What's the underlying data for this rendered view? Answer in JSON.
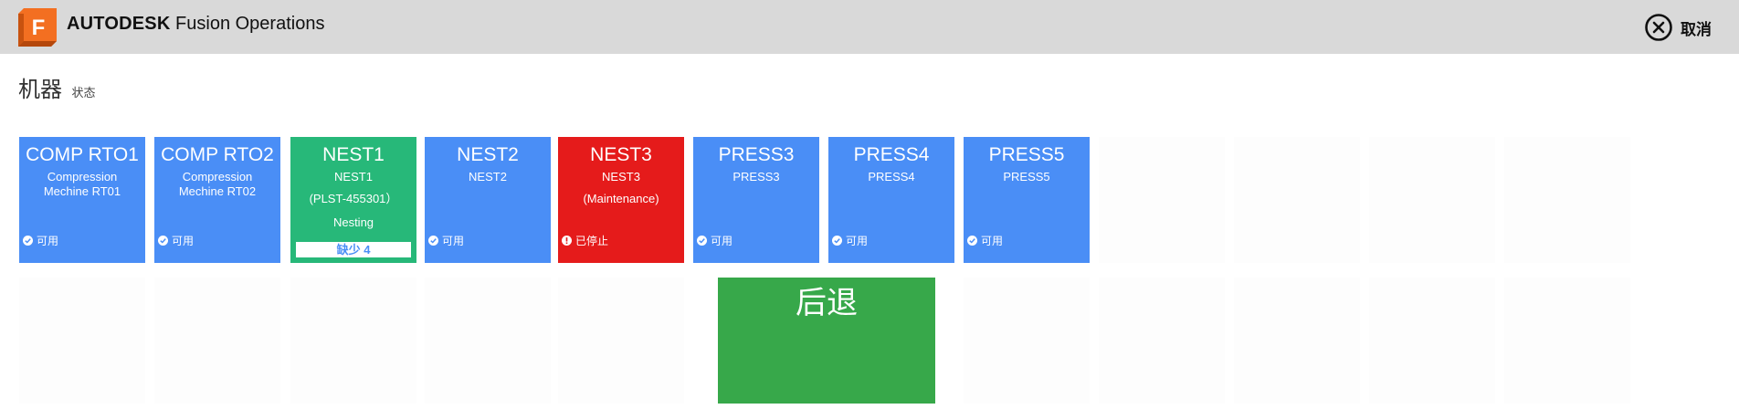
{
  "header": {
    "brand_bold": "AUTODESK",
    "brand_product": "Fusion Operations",
    "logo_letter": "F",
    "cancel_label": "取消"
  },
  "heading": {
    "title": "机器",
    "subtitle": "状态"
  },
  "machines": [
    {
      "name": "COMP RTO1",
      "line1": "Compression",
      "line2": "Mechine RT01",
      "status": "可用",
      "color": "#4a8ef6"
    },
    {
      "name": "COMP RTO2",
      "line1": "Compression",
      "line2": "Mechine RT02",
      "status": "可用",
      "color": "#4a8ef6"
    },
    {
      "name": "NEST1",
      "line1": "NEST1",
      "line2": "(PLST-455301）",
      "line3": "Nesting",
      "missing": "缺少 4",
      "color": "#27b879"
    },
    {
      "name": "NEST2",
      "line1": "NEST2",
      "status": "可用",
      "color": "#4a8ef6"
    },
    {
      "name": "NEST3",
      "line1": "NEST3",
      "line2": "(Maintenance)",
      "status": "已停止",
      "color": "#e51b1b"
    },
    {
      "name": "PRESS3",
      "line1": "PRESS3",
      "status": "可用",
      "color": "#4a8ef6"
    },
    {
      "name": "PRESS4",
      "line1": "PRESS4",
      "status": "可用",
      "color": "#4a8ef6"
    },
    {
      "name": "PRESS5",
      "line1": "PRESS5",
      "status": "可用",
      "color": "#4a8ef6"
    }
  ],
  "back_button": {
    "label": "后退",
    "color": "#37a84a"
  },
  "icons": {
    "logo": "fusion-logo-icon",
    "cancel": "close-circle-icon",
    "available": "check-circle-icon",
    "stopped": "alert-circle-icon"
  }
}
